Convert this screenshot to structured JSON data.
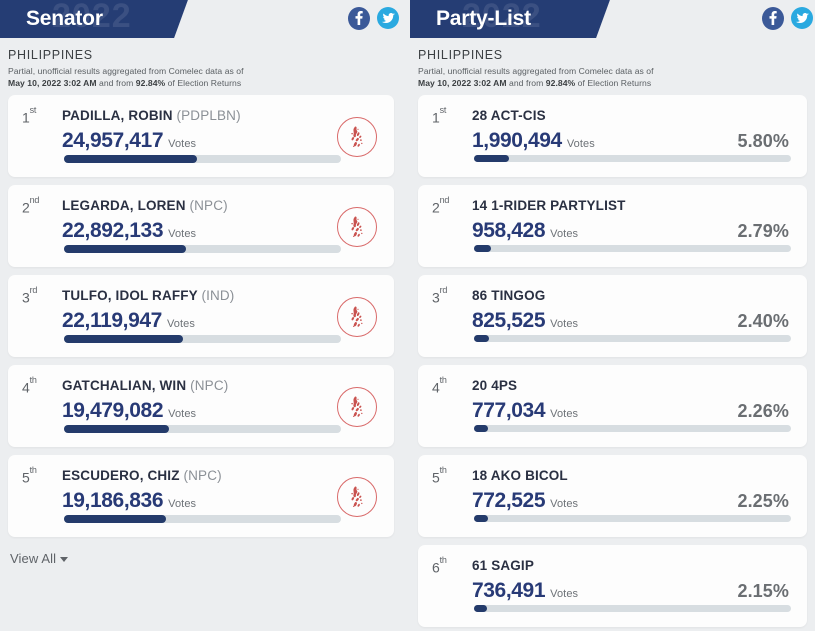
{
  "senator": {
    "banner_title": "Senator",
    "banner_watermark": "2022",
    "region": "PHILIPPINES",
    "subtitle_line1": "Partial, unofficial results aggregated from Comelec data as of",
    "subtitle_date": "May 10, 2022 3:02 AM",
    "subtitle_mid": " and from ",
    "subtitle_pct": "92.84%",
    "subtitle_end": " of Election Returns",
    "social": {
      "facebook": "facebook-icon",
      "twitter": "twitter-icon"
    },
    "view_all": "View All",
    "rows": [
      {
        "rank": "1",
        "ordinal": "st",
        "name": "PADILLA, ROBIN",
        "party": "(PDPLBN)",
        "votes": "24,957,417",
        "votes_label": "Votes",
        "bar_pct": 48
      },
      {
        "rank": "2",
        "ordinal": "nd",
        "name": "LEGARDA, LOREN",
        "party": "(NPC)",
        "votes": "22,892,133",
        "votes_label": "Votes",
        "bar_pct": 44
      },
      {
        "rank": "3",
        "ordinal": "rd",
        "name": "TULFO, IDOL RAFFY",
        "party": "(IND)",
        "votes": "22,119,947",
        "votes_label": "Votes",
        "bar_pct": 43
      },
      {
        "rank": "4",
        "ordinal": "th",
        "name": "GATCHALIAN, WIN",
        "party": "(NPC)",
        "votes": "19,479,082",
        "votes_label": "Votes",
        "bar_pct": 38
      },
      {
        "rank": "5",
        "ordinal": "th",
        "name": "ESCUDERO, CHIZ",
        "party": "(NPC)",
        "votes": "19,186,836",
        "votes_label": "Votes",
        "bar_pct": 37
      }
    ]
  },
  "partylist": {
    "banner_title": "Party-List",
    "banner_watermark": "2022",
    "region": "PHILIPPINES",
    "subtitle_line1": "Partial, unofficial results aggregated from Comelec data as of",
    "subtitle_date": "May 10, 2022 3:02 AM",
    "subtitle_mid": " and from ",
    "subtitle_pct": "92.84%",
    "subtitle_end": " of Election Returns",
    "social": {
      "facebook": "facebook-icon",
      "twitter": "twitter-icon"
    },
    "rows": [
      {
        "rank": "1",
        "ordinal": "st",
        "name": "28 ACT-CIS",
        "votes": "1,990,494",
        "votes_label": "Votes",
        "pct": "5.80%",
        "bar_pct": 11
      },
      {
        "rank": "2",
        "ordinal": "nd",
        "name": "14 1-RIDER PARTYLIST",
        "votes": "958,428",
        "votes_label": "Votes",
        "pct": "2.79%",
        "bar_pct": 5.3
      },
      {
        "rank": "3",
        "ordinal": "rd",
        "name": "86 TINGOG",
        "votes": "825,525",
        "votes_label": "Votes",
        "pct": "2.40%",
        "bar_pct": 4.6
      },
      {
        "rank": "4",
        "ordinal": "th",
        "name": "20 4PS",
        "votes": "777,034",
        "votes_label": "Votes",
        "pct": "2.26%",
        "bar_pct": 4.3
      },
      {
        "rank": "5",
        "ordinal": "th",
        "name": "18 AKO BICOL",
        "votes": "772,525",
        "votes_label": "Votes",
        "pct": "2.25%",
        "bar_pct": 4.3
      },
      {
        "rank": "6",
        "ordinal": "th",
        "name": "61 SAGIP",
        "votes": "736,491",
        "votes_label": "Votes",
        "pct": "2.15%",
        "bar_pct": 4.1
      }
    ]
  },
  "colors": {
    "banner_bg": "#253d74",
    "votes_navy": "#283a76",
    "bar_fill": "#243b6b",
    "bar_track": "#d7dde1",
    "page_bg": "#eceef0",
    "avatar_red": "#d96a6a",
    "facebook_blue": "#3b5998",
    "twitter_blue": "#2aa9e0"
  }
}
